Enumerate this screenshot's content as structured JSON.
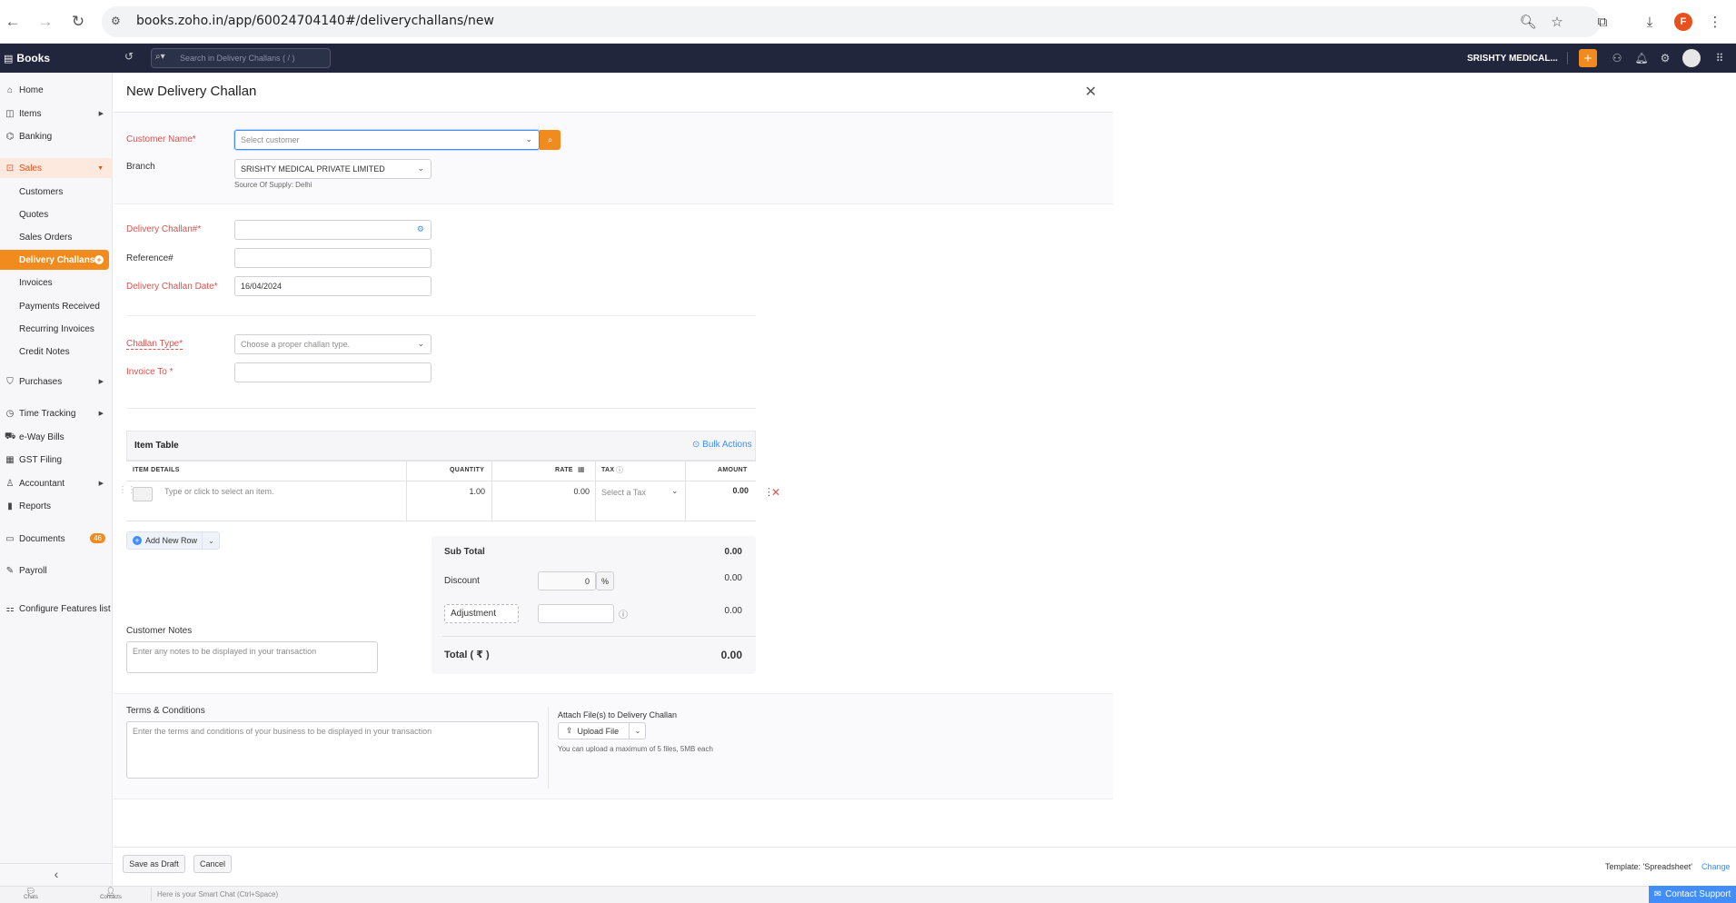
{
  "browser": {
    "url": "books.zoho.in/app/60024704140#/deliverychallans/new",
    "profile_initial": "F"
  },
  "header": {
    "brand": "Books",
    "search_placeholder": "Search in Delivery Challans ( / )",
    "org_name": "SRISHTY MEDICAL...",
    "plus": "+"
  },
  "sidebar": {
    "home": "Home",
    "items": "Items",
    "banking": "Banking",
    "sales": "Sales",
    "sales_sub": [
      "Customers",
      "Quotes",
      "Sales Orders",
      "Delivery Challans",
      "Invoices",
      "Payments Received",
      "Recurring Invoices",
      "Credit Notes"
    ],
    "purchases": "Purchases",
    "time_tracking": "Time Tracking",
    "eway": "e-Way Bills",
    "gst": "GST Filing",
    "accountant": "Accountant",
    "reports": "Reports",
    "documents": "Documents",
    "documents_badge": "46",
    "payroll": "Payroll",
    "configure": "Configure Features list"
  },
  "form": {
    "title": "New Delivery Challan",
    "customer_label": "Customer Name*",
    "customer_placeholder": "Select customer",
    "branch_label": "Branch",
    "branch_value": "SRISHTY MEDICAL PRIVATE LIMITED",
    "source_of_supply": "Source Of Supply: Delhi",
    "dc_number_label": "Delivery Challan#*",
    "reference_label": "Reference#",
    "dc_date_label": "Delivery Challan Date*",
    "dc_date_value": "16/04/2024",
    "challan_type_label": "Challan Type*",
    "challan_type_placeholder": "Choose a proper challan type.",
    "invoice_to_label": "Invoice To *"
  },
  "item_table": {
    "title": "Item Table",
    "bulk_actions": "Bulk Actions",
    "headers": {
      "item_details": "ITEM DETAILS",
      "quantity": "QUANTITY",
      "rate": "RATE",
      "tax": "TAX",
      "amount": "AMOUNT"
    },
    "row": {
      "item_placeholder": "Type or click to select an item.",
      "quantity": "1.00",
      "rate": "0.00",
      "tax_placeholder": "Select a Tax",
      "amount": "0.00"
    },
    "add_row": "Add New Row"
  },
  "totals": {
    "sub_total_label": "Sub Total",
    "sub_total": "0.00",
    "discount_label": "Discount",
    "discount_value": "0",
    "discount_unit": "%",
    "discount_amount": "0.00",
    "adjustment_label": "Adjustment",
    "adjustment_amount": "0.00",
    "total_label": "Total ( ₹ )",
    "total": "0.00"
  },
  "notes": {
    "label": "Customer Notes",
    "placeholder": "Enter any notes to be displayed in your transaction"
  },
  "terms": {
    "label": "Terms & Conditions",
    "placeholder": "Enter the terms and conditions of your business to be displayed in your transaction",
    "attach_label": "Attach File(s) to Delivery Challan",
    "upload_label": "Upload File",
    "upload_hint": "You can upload a maximum of 5 files, 5MB each"
  },
  "footer": {
    "save_draft": "Save as Draft",
    "cancel": "Cancel",
    "template": "Template: 'Spreadsheet'",
    "change": "Change"
  },
  "bottom_bar": {
    "chats": "Chats",
    "contacts": "Contacts",
    "smart_chat": "Here is your Smart Chat (Ctrl+Space)",
    "contact_support": "Contact Support"
  }
}
